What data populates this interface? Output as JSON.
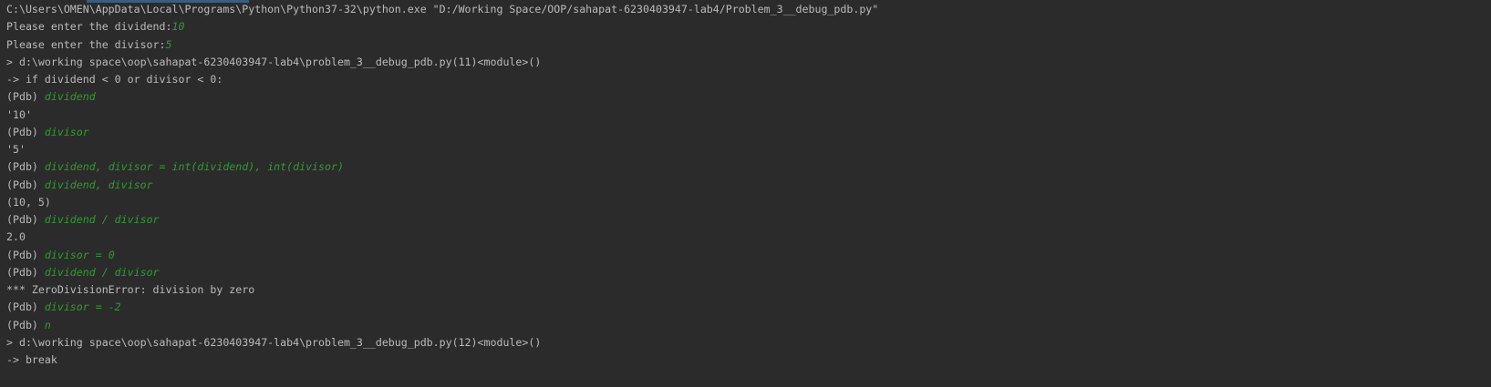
{
  "colors": {
    "background": "#2b2b2b",
    "output": "#bbbbbb",
    "user_input": "#2e9d2e"
  },
  "lines": [
    {
      "text": "C:\\Users\\OMEN\\AppData\\Local\\Programs\\Python\\Python37-32\\python.exe \"D:/Working Space/OOP/sahapat-6230403947-lab4/Problem_3__debug_pdb.py\"",
      "input": ""
    },
    {
      "text": "Please enter the dividend:",
      "input": "10"
    },
    {
      "text": "Please enter the divisor:",
      "input": "5"
    },
    {
      "text": "> d:\\working space\\oop\\sahapat-6230403947-lab4\\problem_3__debug_pdb.py(11)<module>()",
      "input": ""
    },
    {
      "text": "-> if dividend < 0 or divisor < 0:",
      "input": ""
    },
    {
      "text": "(Pdb) ",
      "input": "dividend"
    },
    {
      "text": "'10'",
      "input": ""
    },
    {
      "text": "(Pdb) ",
      "input": "divisor"
    },
    {
      "text": "'5'",
      "input": ""
    },
    {
      "text": "(Pdb) ",
      "input": "dividend, divisor = int(dividend), int(divisor)"
    },
    {
      "text": "(Pdb) ",
      "input": "dividend, divisor"
    },
    {
      "text": "(10, 5)",
      "input": ""
    },
    {
      "text": "(Pdb) ",
      "input": "dividend / divisor"
    },
    {
      "text": "2.0",
      "input": ""
    },
    {
      "text": "(Pdb) ",
      "input": "divisor = 0"
    },
    {
      "text": "(Pdb) ",
      "input": "dividend / divisor"
    },
    {
      "text": "*** ZeroDivisionError: division by zero",
      "input": ""
    },
    {
      "text": "(Pdb) ",
      "input": "divisor = -2"
    },
    {
      "text": "(Pdb) ",
      "input": "n"
    },
    {
      "text": "> d:\\working space\\oop\\sahapat-6230403947-lab4\\problem_3__debug_pdb.py(12)<module>()",
      "input": ""
    },
    {
      "text": "-> break",
      "input": ""
    }
  ]
}
